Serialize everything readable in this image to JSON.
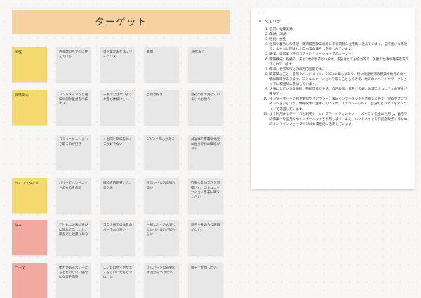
{
  "banner": {
    "title": "ターゲット"
  },
  "rows": [
    {
      "category": "属性",
      "color": "#f6d96c",
      "notes": [
        "西多摩のちかくに住んでいる",
        "自営業かまたはフリーランス",
        "着都",
        "30代まで"
      ]
    },
    {
      "category": "興味関心",
      "color": "#f6d96c",
      "notes": [
        "ハンドメイドなど趣味や何か生業をの作ゲス",
        "一家でできないような遊び体験ほしい",
        "自然が好き",
        "会社の中で貢っていましいと願う"
      ]
    },
    {
      "category": "",
      "color": "",
      "notes": [
        "コミュニケーションを取るのが好き",
        "人と同じ興味を持くるが好でない",
        "SDGsに関心がある",
        "共通事の影響や地元に出身で特に興味がある"
      ]
    },
    {
      "category": "ライフスタイル",
      "color": "#f6d96c",
      "notes": [
        "バザーでハンドメイドのものを作る",
        "購読者的影響い人、自然派",
        "生活レベルの意識が高い",
        "行事に参加できき習得さん、コミュニケーションを常に取りたがい"
      ]
    },
    {
      "category": "悩み",
      "color": "#f2a9a0",
      "notes": [
        "こどもに公園に遊びに連れてほしいと、都会だと遠慮がある",
        "コロナ禍での休日のバー予んが遊い",
        "一緒にたくさん遊びたいけど体力が続かない",
        "親子や夫の合う時期がない..."
      ]
    },
    {
      "category": "ニーズ",
      "color": "#f2a9a0",
      "notes": [
        "体力がある若い子たちとたのしい、優宏になるぞ面影",
        "工いた自然でやや大人をしいいたもなでほしい",
        "少しハードな運動で体流がらつけたい",
        "親子で参加したい"
      ]
    }
  ],
  "note_meta": "...",
  "persona": {
    "handle": "⋮⋮",
    "title": "ペルソナ",
    "items": [
      "名前：佐藤美穂",
      "年齢：35歳",
      "性別：女性",
      "住所や暮らしの環境：東京都西多摩地域にある閑静な住宅街に住んでいます。自然豊かな環境で、山や川に囲まれた自由度の暮らしを楽しんでいます。",
      "職業：自営業（手作りアクセサリーショップのオーナー）",
      "家族構成：既婚で、夫と2歳の息子がいます。家族はとても協力的で、美穂の仕事や趣味を支えてくれています。",
      "年収：世帯年収は700万円程度です。",
      "興味関心ごと：自然やハンドメイド、SDGsに関心があり、特に地産地消の野菜や地元の食べ物に興味があります。コミュニケーションを取ることも好きで、地域のイベントやワークショップに積極的に参加しています。",
      "大事にしている価値観：持続可能な生活、自己表現、家族との絆、地域コミュニティの支援が重要です。",
      "インターネットの利用頻度やリテラシー：毎日インターネットを利用して各で、SNSやオンラインショッピング、情報収集に活用しています。リテラシーも高く、自身のビジネスをオンラインで運営しています。",
      "よく利用するデバイスと利用シーン：スマートフォンやノートパソコンを主に利用し、自宅での作業や外出先でもインターネットを利用します。また、ハンドメイドの作品を販売するためのオンラインショップやSNSも積極的に活用しています。"
    ]
  }
}
